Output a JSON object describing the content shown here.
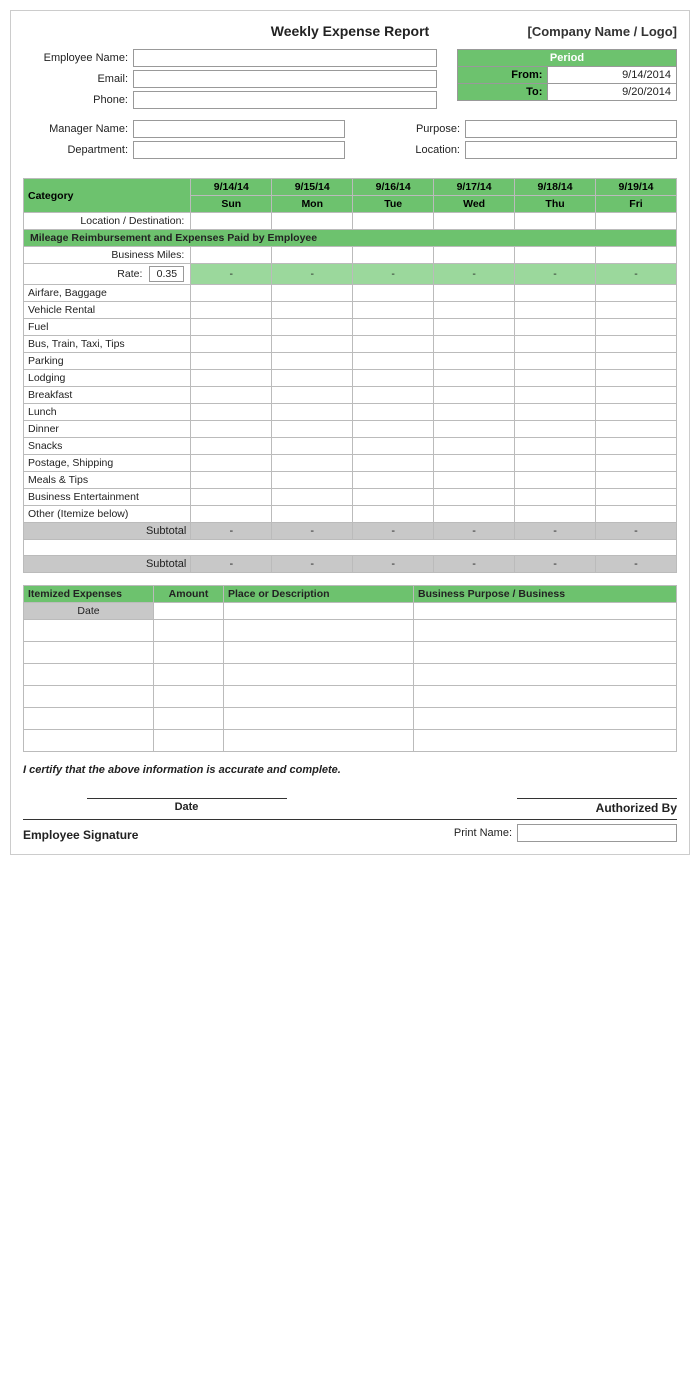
{
  "header": {
    "title": "Weekly Expense Report",
    "company": "[Company Name / Logo]"
  },
  "employee": {
    "name_label": "Employee Name:",
    "email_label": "Email:",
    "phone_label": "Phone:",
    "manager_label": "Manager Name:",
    "department_label": "Department:",
    "purpose_label": "Purpose:",
    "location_label": "Location:"
  },
  "period": {
    "header": "Period",
    "from_label": "From:",
    "from_value": "9/14/2014",
    "to_label": "To:",
    "to_value": "9/20/2014"
  },
  "table": {
    "category_label": "Category",
    "dates": [
      "9/14/14",
      "9/15/14",
      "9/16/14",
      "9/17/14",
      "9/18/14",
      "9/19/14"
    ],
    "days": [
      "Sun",
      "Mon",
      "Tue",
      "Wed",
      "Thu",
      "Fri"
    ],
    "location_row": "Location / Destination:",
    "mileage_section": "Mileage Reimbursement and Expenses Paid by Employee",
    "business_miles_label": "Business Miles:",
    "rate_label": "Rate:",
    "rate_value": "0.35",
    "dash": "-",
    "categories": [
      "Airfare, Baggage",
      "Vehicle Rental",
      "Fuel",
      "Bus, Train, Taxi, Tips",
      "Parking",
      "Lodging",
      "Breakfast",
      "Lunch",
      "Dinner",
      "Snacks",
      "Postage, Shipping",
      "Meals & Tips",
      "Business Entertainment",
      "Other (Itemize below)"
    ],
    "subtotal_label": "Subtotal"
  },
  "itemized": {
    "header": "Itemized Expenses",
    "amount_col": "Amount",
    "place_col": "Place or Description",
    "purpose_col": "Business Purpose / Business",
    "date_col": "Date"
  },
  "certification": {
    "text": "I certify that the above information is accurate and complete."
  },
  "signature": {
    "date_label": "Date",
    "authorized_label": "Authorized By",
    "employee_sig_label": "Employee Signature",
    "print_name_label": "Print Name:"
  }
}
